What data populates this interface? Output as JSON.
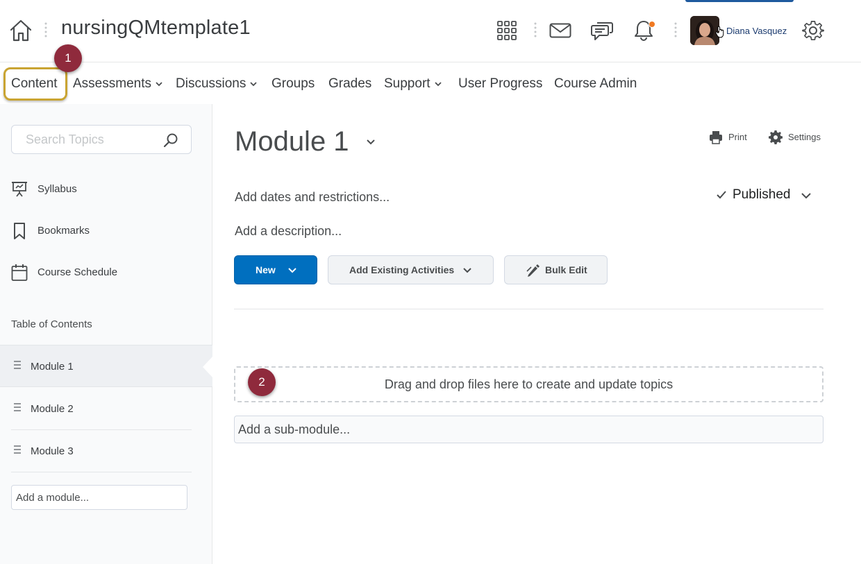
{
  "header": {
    "course_title": "nursingQMtemplate1",
    "user_name": "Diana Vasquez",
    "icons": [
      "home-icon",
      "apps-grid-icon",
      "mail-icon",
      "chat-icon",
      "bell-icon",
      "gear-icon"
    ],
    "notification_color": "#f07a22"
  },
  "nav": {
    "items": [
      {
        "label": "Content",
        "dropdown": false
      },
      {
        "label": "Assessments",
        "dropdown": true
      },
      {
        "label": "Discussions",
        "dropdown": true
      },
      {
        "label": "Groups",
        "dropdown": false
      },
      {
        "label": "Grades",
        "dropdown": false
      },
      {
        "label": "Support",
        "dropdown": true
      },
      {
        "label": "User Progress",
        "dropdown": false
      },
      {
        "label": "Course Admin",
        "dropdown": false
      }
    ]
  },
  "callouts": {
    "step1": "1",
    "step2": "2",
    "highlight_color": "#c9a432",
    "badge_color": "#8f2a3c"
  },
  "sidebar": {
    "search_placeholder": "Search Topics",
    "links": [
      {
        "label": "Syllabus",
        "icon": "presentation-icon"
      },
      {
        "label": "Bookmarks",
        "icon": "bookmark-icon"
      },
      {
        "label": "Course Schedule",
        "icon": "calendar-icon"
      }
    ],
    "toc_title": "Table of Contents",
    "modules": [
      "Module 1",
      "Module 2",
      "Module 3"
    ],
    "active_module": "Module 1",
    "add_module": "Add a module..."
  },
  "main": {
    "title": "Module 1",
    "print_label": "Print",
    "settings_label": "Settings",
    "dates_link": "Add dates and restrictions...",
    "status": "Published",
    "description_link": "Add a description...",
    "buttons": {
      "new": "New",
      "add_existing": "Add Existing Activities",
      "bulk_edit": "Bulk Edit"
    },
    "dropzone_text": "Drag and drop files here to create and update topics",
    "add_submodule": "Add a sub-module...",
    "primary_color": "#006fbf"
  }
}
